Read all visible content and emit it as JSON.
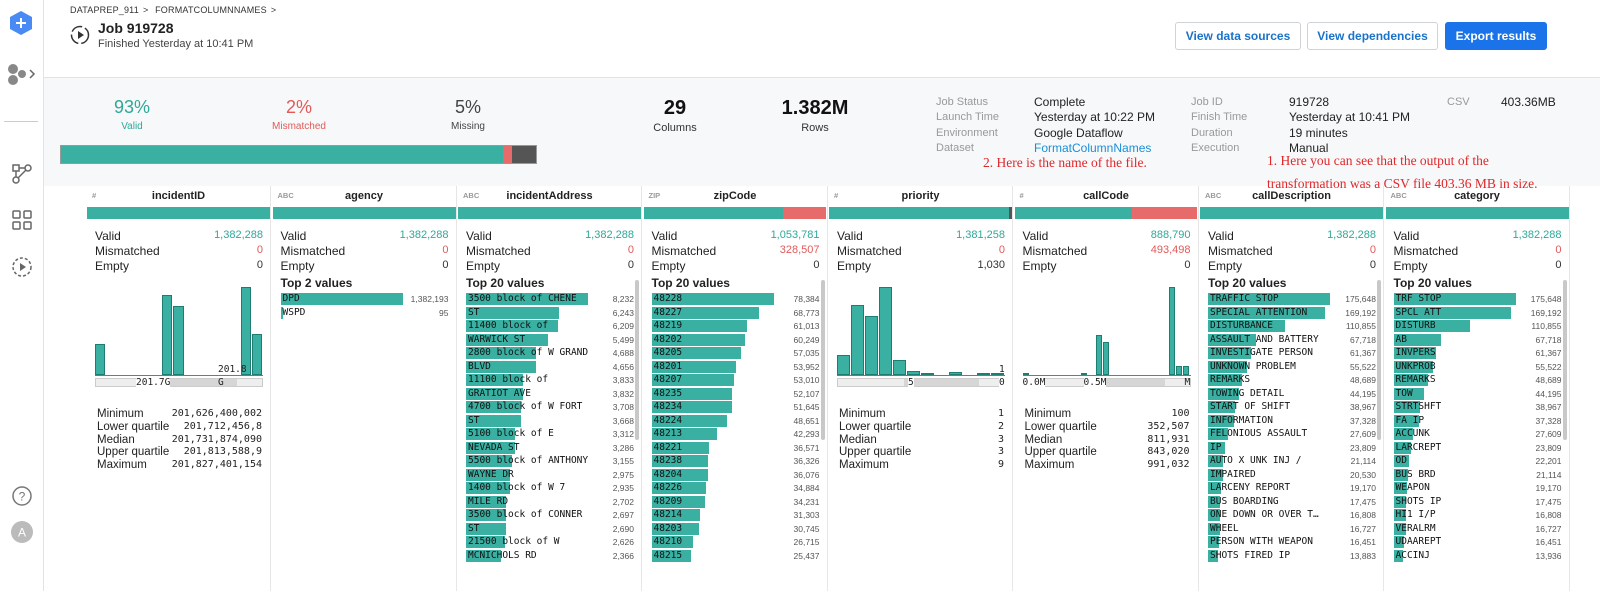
{
  "breadcrumb": [
    "DATAPREP_911",
    "FORMATCOLUMNNAMES"
  ],
  "job": {
    "title": "Job 919728",
    "subtitle": "Finished Yesterday at 10:41 PM"
  },
  "buttons": {
    "view_sources": "View data sources",
    "view_deps": "View dependencies",
    "export": "Export results"
  },
  "summary": {
    "valid": {
      "value": "93%",
      "label": "Valid"
    },
    "mismatched": {
      "value": "2%",
      "label": "Mismatched"
    },
    "missing": {
      "value": "5%",
      "label": "Missing"
    },
    "columns": {
      "value": "29",
      "label": "Columns"
    },
    "rows": {
      "value": "1.382M",
      "label": "Rows"
    },
    "quality_fractions": {
      "valid": 0.93,
      "mismatched": 0.02,
      "missing": 0.05
    }
  },
  "job_meta": {
    "keys": [
      "Job Status",
      "Launch Time",
      "Environment",
      "Dataset"
    ],
    "values": [
      "Complete",
      "Yesterday at 10:22 PM",
      "Google Dataflow",
      "FormatColumnNames"
    ],
    "keys2": [
      "Job ID",
      "Finish Time",
      "Duration",
      "Execution"
    ],
    "values2": [
      "919728",
      "Yesterday at 10:41 PM",
      "19 minutes",
      "Manual"
    ],
    "output_type": "CSV",
    "output_size": "403.36MB"
  },
  "annotations": {
    "file_name": "2. Here is the name of the file.",
    "output_line1": "1. Here you can see that the output of the",
    "output_line2": "transformation was a CSV file 403.36 MB in size."
  },
  "colors": {
    "valid": "#3ab0a2",
    "mismatch": "#e86b6b",
    "missing": "#555555",
    "accent": "#1a73e8"
  },
  "labels": {
    "valid": "Valid",
    "mismatched": "Mismatched",
    "empty": "Empty",
    "top20": "Top 20 values",
    "top2": "Top 2 values",
    "min": "Minimum",
    "lq": "Lower quartile",
    "median": "Median",
    "uq": "Upper quartile",
    "max": "Maximum"
  },
  "columns": [
    {
      "type": "#",
      "name": "incidentID",
      "valid": "1,382,288",
      "mismatched": "0",
      "empty": "0",
      "valid_frac": 1.0,
      "mismatch_frac": 0.0,
      "missing_frac": 0.0,
      "hist": [
        0.35,
        0,
        0,
        0,
        0,
        0.0,
        0.91,
        0.78,
        0,
        0,
        0,
        0,
        0,
        1.0,
        0.47
      ],
      "axis": [
        "201.7G",
        "201.8",
        "G"
      ],
      "stats": [
        "201,626,400,002",
        "201,712,456,8",
        "201,731,874,090",
        "201,813,588,9",
        "201,827,401,154"
      ]
    },
    {
      "type": "ABC",
      "name": "agency",
      "valid": "1,382,288",
      "mismatched": "0",
      "empty": "0",
      "valid_frac": 1.0,
      "mismatch_frac": 0.0,
      "missing_frac": 0.0,
      "top_title": "Top 2 values",
      "top": [
        [
          "DPD",
          "1,382,193",
          1.0
        ],
        [
          "WSPD",
          "95",
          0.01
        ]
      ]
    },
    {
      "type": "ABC",
      "name": "incidentAddress",
      "valid": "1,382,288",
      "mismatched": "0",
      "empty": "0",
      "valid_frac": 1.0,
      "mismatch_frac": 0.0,
      "missing_frac": 0.0,
      "top_title": "Top 20 values",
      "top": [
        [
          "3500 block of CHENE",
          "8,232",
          1.0
        ],
        [
          "ST",
          "6,243",
          0.76
        ],
        [
          "11400 block of",
          "6,209",
          0.75
        ],
        [
          "WARWICK ST",
          "5,499",
          0.67
        ],
        [
          "2800 block of W GRAND",
          "4,688",
          0.57
        ],
        [
          "BLVD",
          "4,656",
          0.57
        ],
        [
          "11100 block of",
          "3,833",
          0.47
        ],
        [
          "GRATIOT AVE",
          "3,832",
          0.47
        ],
        [
          "4700 block of W FORT",
          "3,708",
          0.45
        ],
        [
          "ST",
          "3,668",
          0.45
        ],
        [
          "5100 block of E",
          "3,312",
          0.4
        ],
        [
          "NEVADA ST",
          "3,286",
          0.4
        ],
        [
          "5500 block of ANTHONY",
          "3,155",
          0.38
        ],
        [
          "WAYNE DR",
          "2,975",
          0.36
        ],
        [
          "1400 block of W 7",
          "2,935",
          0.36
        ],
        [
          "MILE RD",
          "2,702",
          0.33
        ],
        [
          "3500 block of CONNER",
          "2,697",
          0.33
        ],
        [
          "ST",
          "2,690",
          0.33
        ],
        [
          "21500 block of W",
          "2,626",
          0.32
        ],
        [
          "MCNICHOLS RD",
          "2,366",
          0.29
        ]
      ]
    },
    {
      "type": "ZIP",
      "name": "zipCode",
      "valid": "1,053,781",
      "mismatched": "328,507",
      "empty": "0",
      "valid_frac": 0.76,
      "mismatch_frac": 0.24,
      "missing_frac": 0.0,
      "top_title": "Top 20 values",
      "top": [
        [
          "48228",
          "78,384",
          1.0
        ],
        [
          "48227",
          "68,773",
          0.88
        ],
        [
          "48219",
          "61,013",
          0.78
        ],
        [
          "48202",
          "60,249",
          0.77
        ],
        [
          "48205",
          "57,035",
          0.73
        ],
        [
          "48201",
          "53,952",
          0.69
        ],
        [
          "48207",
          "53,010",
          0.68
        ],
        [
          "48235",
          "52,107",
          0.66
        ],
        [
          "48234",
          "51,645",
          0.66
        ],
        [
          "48224",
          "48,651",
          0.62
        ],
        [
          "48213",
          "42,293",
          0.54
        ],
        [
          "48221",
          "36,571",
          0.47
        ],
        [
          "48238",
          "36,326",
          0.46
        ],
        [
          "48204",
          "36,076",
          0.46
        ],
        [
          "48226",
          "34,884",
          0.45
        ],
        [
          "48209",
          "34,231",
          0.44
        ],
        [
          "48214",
          "31,303",
          0.4
        ],
        [
          "48203",
          "30,745",
          0.39
        ],
        [
          "48210",
          "26,715",
          0.34
        ],
        [
          "48215",
          "25,437",
          0.32
        ]
      ]
    },
    {
      "type": "#",
      "name": "priority",
      "valid": "1,381,258",
      "mismatched": "0",
      "empty": "1,030",
      "valid_frac": 0.985,
      "mismatch_frac": 0.0,
      "missing_frac": 0.015,
      "hist": [
        0.23,
        0.79,
        0.67,
        1.0,
        0.17,
        0.05,
        0.02,
        0,
        0.03,
        0,
        0.02,
        0.02
      ],
      "axis": [
        "5",
        "0",
        "1"
      ],
      "stats": [
        "1",
        "2",
        "3",
        "3",
        "9"
      ]
    },
    {
      "type": "#",
      "name": "callCode",
      "valid": "888,790",
      "mismatched": "493,498",
      "empty": "0",
      "valid_frac": 0.64,
      "mismatch_frac": 0.36,
      "missing_frac": 0.0,
      "hist": [
        0.02,
        0,
        0,
        0,
        0,
        0,
        0,
        0,
        0.02,
        0,
        0.45,
        0.38,
        0,
        0,
        0,
        0,
        0,
        0,
        0,
        0,
        1.0,
        0.1,
        0.1
      ],
      "axis": [
        "0.0M",
        "0.5M",
        "M"
      ],
      "stats": [
        "100",
        "352,507",
        "811,931",
        "843,020",
        "991,032"
      ]
    },
    {
      "type": "ABC",
      "name": "callDescription",
      "valid": "1,382,288",
      "mismatched": "0",
      "empty": "0",
      "valid_frac": 1.0,
      "mismatch_frac": 0.0,
      "missing_frac": 0.0,
      "top_title": "Top 20 values",
      "top": [
        [
          "TRAFFIC STOP",
          "175,648",
          1.0
        ],
        [
          "SPECIAL ATTENTION",
          "169,192",
          0.96
        ],
        [
          "DISTURBANCE",
          "110,855",
          0.63
        ],
        [
          "ASSAULT AND BATTERY",
          "67,718",
          0.39
        ],
        [
          "INVESTIGATE PERSON",
          "61,367",
          0.35
        ],
        [
          "UNKNOWN PROBLEM",
          "55,522",
          0.32
        ],
        [
          "REMARKS",
          "48,689",
          0.28
        ],
        [
          "TOWING DETAIL",
          "44,195",
          0.25
        ],
        [
          "START OF SHIFT",
          "38,967",
          0.22
        ],
        [
          "INFORMATION",
          "37,328",
          0.21
        ],
        [
          "FELONIOUS ASSAULT",
          "27,609",
          0.16
        ],
        [
          "IP",
          "23,809",
          0.14
        ],
        [
          "AUTO X UNK INJ /",
          "21,114",
          0.12
        ],
        [
          "IMPAIRED",
          "20,530",
          0.12
        ],
        [
          "LARCENY REPORT",
          "19,170",
          0.11
        ],
        [
          "BUS BOARDING",
          "17,475",
          0.1
        ],
        [
          "ONE DOWN OR OVER T…",
          "16,808",
          0.1
        ],
        [
          "WHEEL",
          "16,727",
          0.1
        ],
        [
          "PERSON WITH WEAPON",
          "16,451",
          0.09
        ],
        [
          "SHOTS FIRED IP",
          "13,883",
          0.08
        ]
      ]
    },
    {
      "type": "ABC",
      "name": "category",
      "valid": "1,382,288",
      "mismatched": "0",
      "empty": "0",
      "valid_frac": 1.0,
      "mismatch_frac": 0.0,
      "missing_frac": 0.0,
      "top_title": "Top 20 values",
      "top": [
        [
          "TRF STOP",
          "175,648",
          1.0
        ],
        [
          "SPCL ATT",
          "169,192",
          0.96
        ],
        [
          "DISTURB",
          "110,855",
          0.63
        ],
        [
          "AB",
          "67,718",
          0.39
        ],
        [
          "INVPERS",
          "61,367",
          0.35
        ],
        [
          "UNKPROB",
          "55,522",
          0.32
        ],
        [
          "REMARKS",
          "48,689",
          0.28
        ],
        [
          "TOW",
          "44,195",
          0.25
        ],
        [
          "STRTSHFT",
          "38,967",
          0.22
        ],
        [
          "FA IP",
          "37,328",
          0.21
        ],
        [
          "ACCUNK",
          "27,609",
          0.16
        ],
        [
          "LARCREPT",
          "23,809",
          0.14
        ],
        [
          "OD",
          "22,201",
          0.13
        ],
        [
          "BUS BRD",
          "21,114",
          0.12
        ],
        [
          "WEAPON",
          "19,170",
          0.11
        ],
        [
          "SHOTS IP",
          "17,475",
          0.1
        ],
        [
          "HI1 I/P",
          "16,808",
          0.1
        ],
        [
          "VERALRM",
          "16,727",
          0.1
        ],
        [
          "UDAAREPT",
          "16,451",
          0.09
        ],
        [
          "ACCINJ",
          "13,936",
          0.08
        ]
      ]
    }
  ]
}
